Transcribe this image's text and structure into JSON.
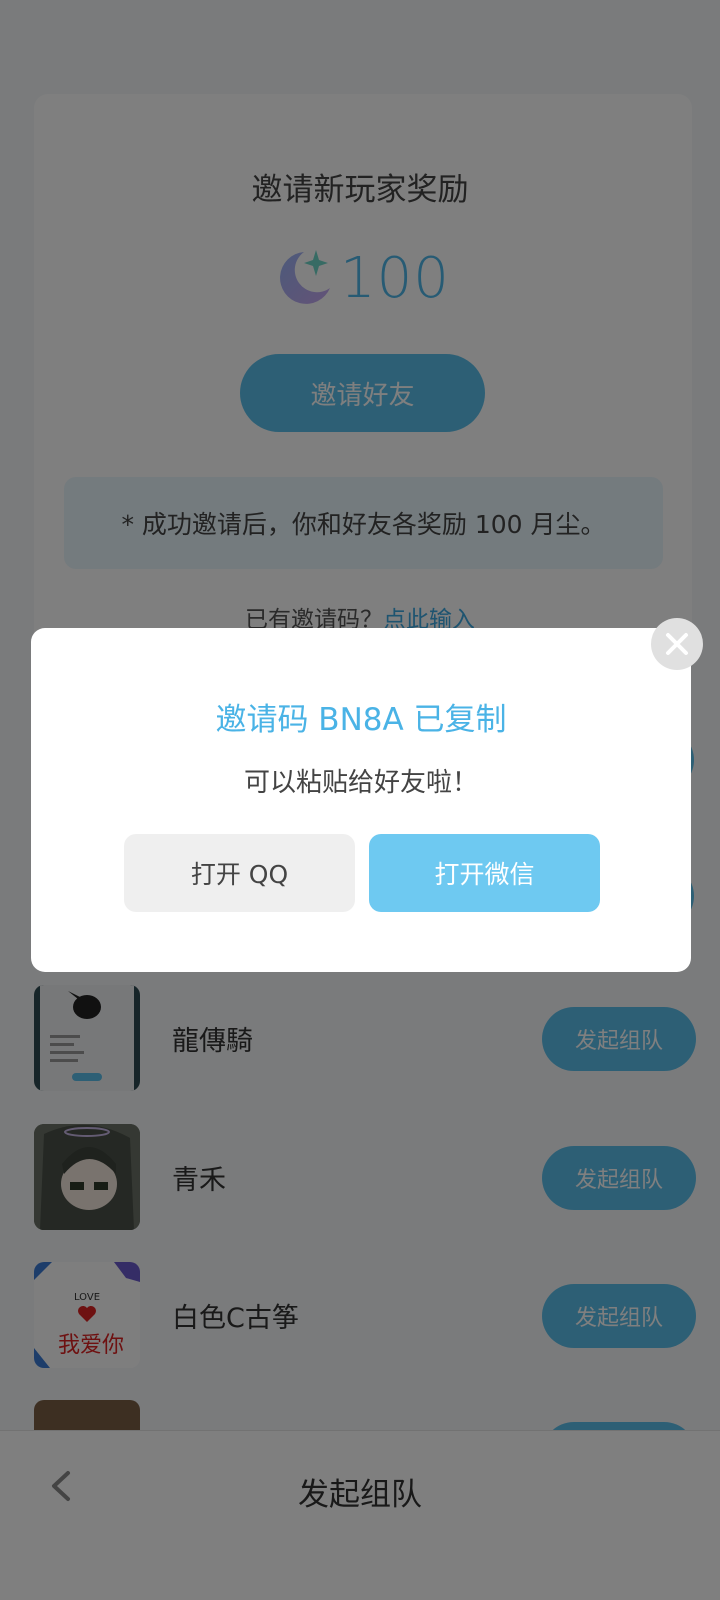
{
  "invite": {
    "title": "邀请新玩家奖励",
    "reward_amount": "100",
    "reward_icon": "moon-star-icon",
    "invite_button": "邀请好友",
    "note": "* 成功邀请后，你和好友各奖励 100 月尘。",
    "code_prompt": "已有邀请码？",
    "code_link": "点此输入"
  },
  "friends": [
    {
      "name": "龍傳騎",
      "button": "发起组队"
    },
    {
      "name": "青禾",
      "button": "发起组队"
    },
    {
      "name": "白色C古筝",
      "button": "发起组队"
    }
  ],
  "avatar_text": {
    "love": "LOVE",
    "wo_ai_ni": "我爱你"
  },
  "bottom_bar": {
    "title": "发起组队"
  },
  "modal": {
    "title": "邀请码 BN8A 已复制",
    "subtitle": "可以粘贴给好友啦！",
    "btn_qq": "打开 QQ",
    "btn_wechat": "打开微信"
  },
  "colors": {
    "accent": "#5bbfea",
    "modal_accent": "#6ec9f1",
    "title_blue": "#4ab3e6",
    "overlay": "rgba(0,0,0,0.5)"
  }
}
